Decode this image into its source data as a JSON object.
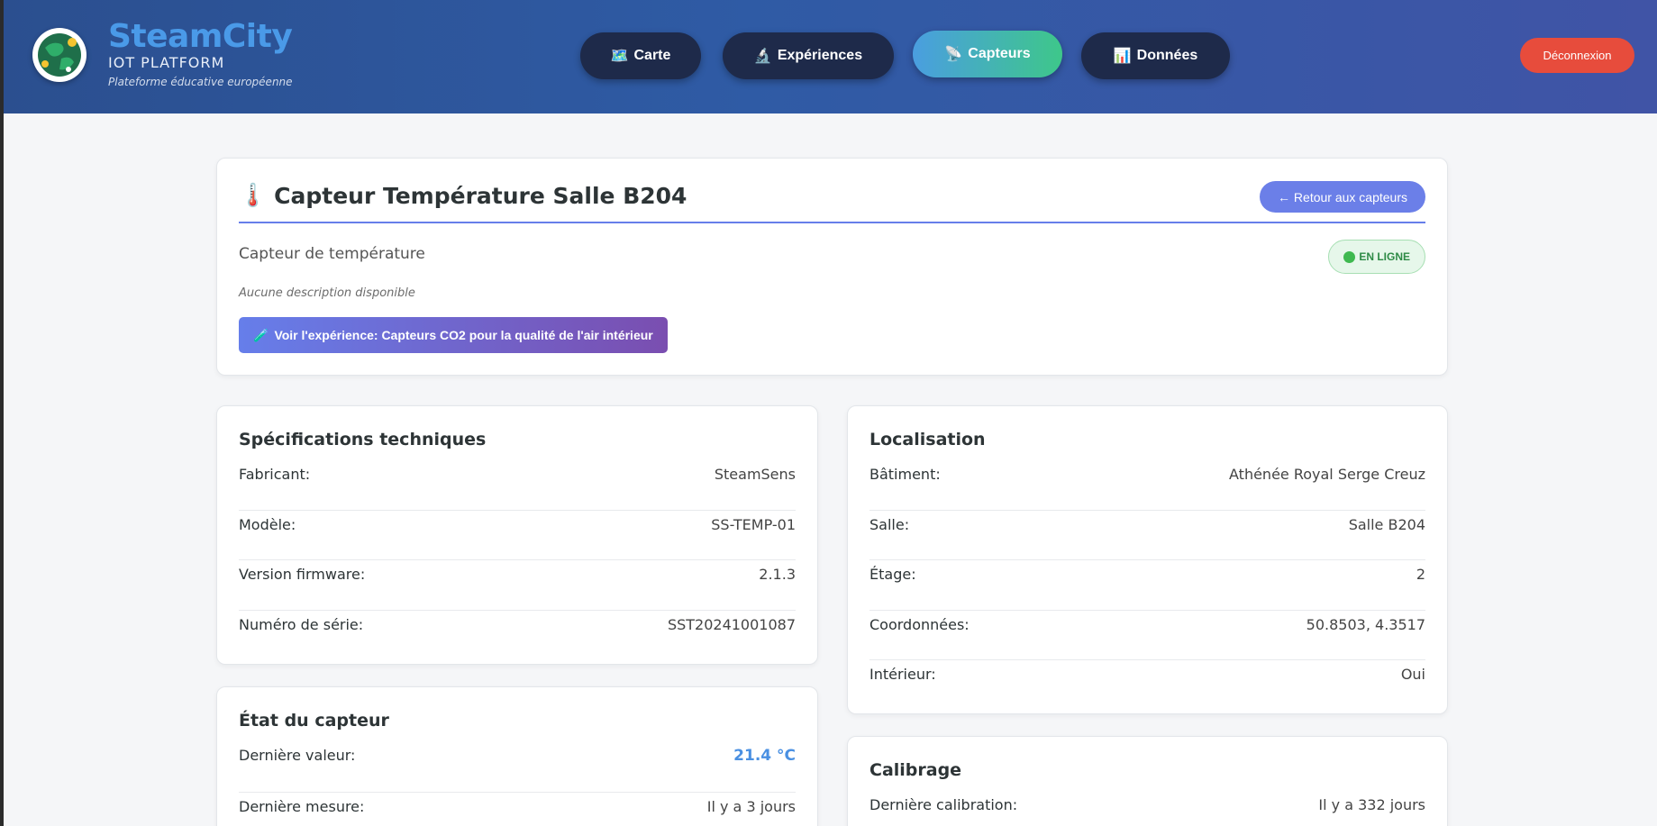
{
  "header": {
    "brand_name": "SteamCity",
    "brand_sub": "IOT PLATFORM",
    "brand_tag": "Plateforme éducative européenne",
    "nav": [
      {
        "icon": "🗺️",
        "label": "Carte"
      },
      {
        "icon": "🔬",
        "label": "Expériences"
      },
      {
        "icon": "📡",
        "label": "Capteurs"
      },
      {
        "icon": "📊",
        "label": "Données"
      }
    ],
    "logout_label": "Déconnexion"
  },
  "sensor": {
    "icon": "🌡️",
    "title": "Capteur Température Salle B204",
    "back_label": "← Retour aux capteurs",
    "type": "Capteur de température",
    "status": "EN LIGNE",
    "description": "Aucune description disponible",
    "experiment_icon": "🧪",
    "experiment_label": "Voir l'expérience: Capteurs CO2 pour la qualité de l'air intérieur"
  },
  "specs": {
    "title": "Spécifications techniques",
    "rows": [
      {
        "k": "Fabricant:",
        "v": "SteamSens"
      },
      {
        "k": "Modèle:",
        "v": "SS-TEMP-01"
      },
      {
        "k": "Version firmware:",
        "v": "2.1.3"
      },
      {
        "k": "Numéro de série:",
        "v": "SST20241001087"
      }
    ]
  },
  "location": {
    "title": "Localisation",
    "rows": [
      {
        "k": "Bâtiment:",
        "v": "Athénée Royal Serge Creuz"
      },
      {
        "k": "Salle:",
        "v": "Salle B204"
      },
      {
        "k": "Étage:",
        "v": "2"
      },
      {
        "k": "Coordonnées:",
        "v": "50.8503, 4.3517"
      },
      {
        "k": "Intérieur:",
        "v": "Oui"
      }
    ]
  },
  "state": {
    "title": "État du capteur",
    "rows": [
      {
        "k": "Dernière valeur:",
        "v": "21.4 °C"
      },
      {
        "k": "Dernière mesure:",
        "v": "Il y a 3 jours"
      }
    ]
  },
  "calibration": {
    "title": "Calibrage",
    "rows": [
      {
        "k": "Dernière calibration:",
        "v": "Il y a 332 jours"
      }
    ]
  }
}
